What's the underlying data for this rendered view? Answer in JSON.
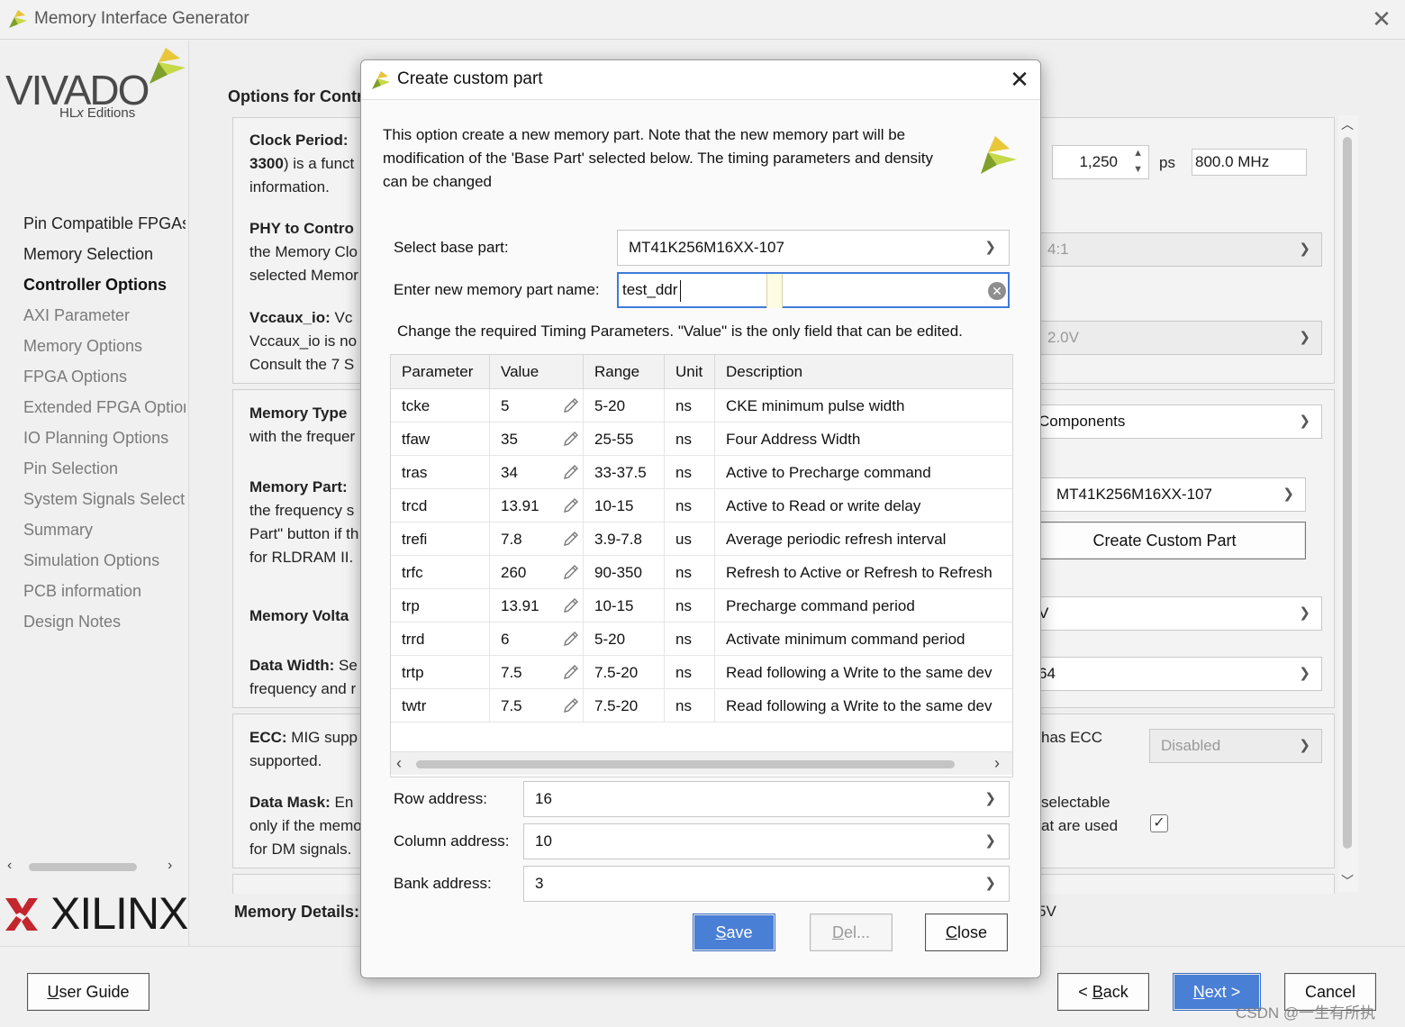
{
  "window": {
    "title": "Memory Interface Generator"
  },
  "left_panel": {
    "brand": {
      "name": "VIVADO",
      "sub_prefix": "HL",
      "sub_x": "x",
      "sub_suffix": " Editions"
    },
    "nav": [
      {
        "label": "Pin Compatible FPGAs",
        "state": "normal"
      },
      {
        "label": "Memory Selection",
        "state": "normal"
      },
      {
        "label": "Controller Options",
        "state": "active"
      },
      {
        "label": "AXI Parameter",
        "state": "disabled"
      },
      {
        "label": "Memory Options",
        "state": "disabled"
      },
      {
        "label": "FPGA Options",
        "state": "disabled"
      },
      {
        "label": "Extended FPGA Options",
        "state": "disabled"
      },
      {
        "label": "IO Planning Options",
        "state": "disabled"
      },
      {
        "label": "Pin Selection",
        "state": "disabled"
      },
      {
        "label": "System Signals Selection",
        "state": "disabled"
      },
      {
        "label": "Summary",
        "state": "disabled"
      },
      {
        "label": "Simulation Options",
        "state": "disabled"
      },
      {
        "label": "PCB information",
        "state": "disabled"
      },
      {
        "label": "Design Notes",
        "state": "disabled"
      }
    ],
    "footer_brand": "XILINX"
  },
  "background": {
    "options_heading": "Options for Contr",
    "clock_period": {
      "bold": "Clock Period:",
      "line1_bold": "3300",
      "line1": ") is a funct",
      "line2": "information.",
      "value": "1,250",
      "unit": "ps",
      "freq": "800.0 MHz"
    },
    "phy": {
      "bold": "PHY to Contro",
      "line1": "the Memory Clo",
      "line2": "selected Memor",
      "select": "4:1"
    },
    "vccaux": {
      "bold": "Vccaux_io:",
      "tail": " Vc",
      "line1": "Vccaux_io is no",
      "line2": "Consult the 7 S",
      "select": "2.0V"
    },
    "memory_type": {
      "bold": "Memory Type",
      "line1": "with the frequer",
      "select": "Components"
    },
    "memory_part": {
      "bold": "Memory Part:",
      "line1": "the frequency s",
      "line2": "Part\" button if th",
      "line3": "for RLDRAM II.",
      "select": "MT41K256M16XX-107",
      "button": "Create Custom Part"
    },
    "memory_voltage": {
      "bold": "Memory Volta",
      "select": "V"
    },
    "data_width": {
      "bold": "Data Width:",
      "tail": " Se",
      "line1": "frequency and r",
      "select": "64"
    },
    "ecc": {
      "bold": "ECC:",
      "tail": " MIG supp",
      "line1": "supported.",
      "right": "has ECC",
      "select": "Disabled"
    },
    "data_mask": {
      "bold": "Data Mask:",
      "tail": " En",
      "line1": "only if the memo",
      "line2": "for DM signals.",
      "right1": "selectable",
      "right2": "at are used"
    },
    "memory_details": {
      "bold": "Memory Details:",
      "right": "5V"
    }
  },
  "dialog": {
    "title": "Create custom part",
    "description": "This option create a new memory part. Note that the new memory part will be modification of the 'Base Part' selected below. The timing parameters and density can be changed",
    "base_part_label": "Select base part:",
    "base_part_value": "MT41K256M16XX-107",
    "name_label": "Enter new memory part name:",
    "name_value": "test_ddr",
    "timing_note": "Change the required Timing Parameters. \"Value\" is the only field that can be edited.",
    "table": {
      "columns": [
        "Parameter",
        "Value",
        "Range",
        "Unit",
        "Description"
      ],
      "rows": [
        {
          "param": "tcke",
          "value": "5",
          "range": "5-20",
          "unit": "ns",
          "desc": "CKE minimum pulse width"
        },
        {
          "param": "tfaw",
          "value": "35",
          "range": "25-55",
          "unit": "ns",
          "desc": "Four Address Width"
        },
        {
          "param": "tras",
          "value": "34",
          "range": "33-37.5",
          "unit": "ns",
          "desc": "Active to Precharge command"
        },
        {
          "param": "trcd",
          "value": "13.91",
          "range": "10-15",
          "unit": "ns",
          "desc": "Active to Read or write delay"
        },
        {
          "param": "trefi",
          "value": "7.8",
          "range": "3.9-7.8",
          "unit": "us",
          "desc": "Average periodic refresh interval"
        },
        {
          "param": "trfc",
          "value": "260",
          "range": "90-350",
          "unit": "ns",
          "desc": "Refresh to Active or Refresh to Refresh"
        },
        {
          "param": "trp",
          "value": "13.91",
          "range": "10-15",
          "unit": "ns",
          "desc": "Precharge command period"
        },
        {
          "param": "trrd",
          "value": "6",
          "range": "5-20",
          "unit": "ns",
          "desc": "Activate minimum command period"
        },
        {
          "param": "trtp",
          "value": "7.5",
          "range": "7.5-20",
          "unit": "ns",
          "desc": "Read following a Write to the same dev"
        },
        {
          "param": "twtr",
          "value": "7.5",
          "range": "7.5-20",
          "unit": "ns",
          "desc": "Read following a Write to the same dev"
        }
      ]
    },
    "row_address_label": "Row address:",
    "row_address_value": "16",
    "column_address_label": "Column address:",
    "column_address_value": "10",
    "bank_address_label": "Bank address:",
    "bank_address_value": "3",
    "buttons": {
      "save_mnemonic": "S",
      "save_rest": "ave",
      "delete_mnemonic": "D",
      "delete_rest": "el...",
      "close_mnemonic": "C",
      "close_rest": "lose"
    }
  },
  "bottom_bar": {
    "user_guide_mnemonic": "U",
    "user_guide_rest": "ser Guide",
    "back_prefix": "< ",
    "back_mnemonic": "B",
    "back_rest": "ack",
    "next_mnemonic": "N",
    "next_rest": "ext >",
    "cancel": "Cancel"
  },
  "watermark": "CSDN @一生有所执",
  "colors": {
    "accent": "#4a7fd6",
    "focus_border": "#3f7bd9",
    "xilinx_red": "#c4262e",
    "vivado_green": "#a8c431"
  }
}
